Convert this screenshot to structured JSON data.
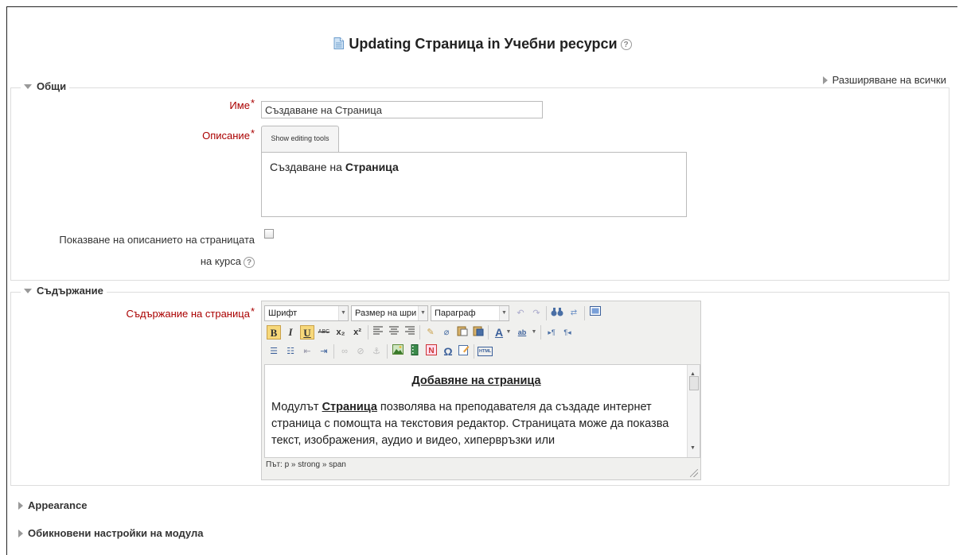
{
  "header": {
    "title": "Updating Страница in Учебни ресурси",
    "help_glyph": "?"
  },
  "expand_all": "Разширяване на всички",
  "general": {
    "legend": "Общи",
    "name_label": "Име",
    "name_value": "Създаване на Страница",
    "description_label": "Описание",
    "show_tools_tab": "Show editing tools",
    "description_text_plain": "Създаване на ",
    "description_text_bold": "Страница",
    "show_description_label_line1": "Показване на описанието на страницата",
    "show_description_label_line2": "на курса",
    "required_star": "*"
  },
  "content": {
    "legend": "Съдържание",
    "page_content_label": "Съдържание на страница",
    "toolbar": {
      "font_select": "Шрифт",
      "size_select": "Размер на шри",
      "format_select": "Параграф",
      "bold": "B",
      "italic": "I",
      "underline": "U",
      "strike": "ABC",
      "sub": "x₂",
      "sup": "x²",
      "font_color": "A",
      "highlight": "ab",
      "html": "HTML",
      "omega": "Ω"
    },
    "editor_heading": "Добавяне на страница",
    "editor_para_before": "Модулът ",
    "editor_para_bold": "Страница",
    "editor_para_after": " позволява на преподавателя да създаде интернет страница с помощта на текстовия редактор. Страницата може да показва текст, изображения, аудио и видео, хипервръзки или",
    "path": "Път: p » strong » span"
  },
  "collapsed_sections": [
    {
      "label": "Appearance"
    },
    {
      "label": "Обикновени настройки на модула"
    }
  ]
}
